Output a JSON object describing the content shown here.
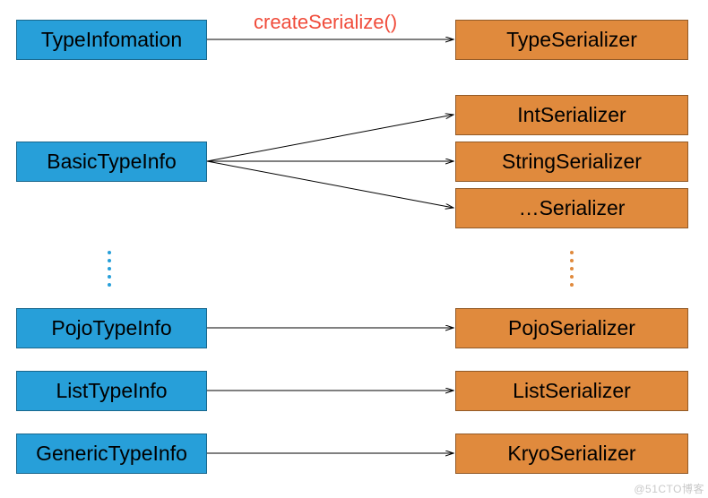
{
  "colors": {
    "blue": "#279fd9",
    "orange": "#e08a3d",
    "label": "#f04c3b",
    "watermark": "#c9c9c9"
  },
  "edgeLabel": "createSerialize()",
  "watermark": "@51CTO博客",
  "leftBoxes": {
    "typeInfo": "TypeInfomation",
    "basicTypeInfo": "BasicTypeInfo",
    "pojoTypeInfo": "PojoTypeInfo",
    "listTypeInfo": "ListTypeInfo",
    "genericTypeInfo": "GenericTypeInfo"
  },
  "rightBoxes": {
    "typeSerializer": "TypeSerializer",
    "intSerializer": "IntSerializer",
    "stringSerializer": "StringSerializer",
    "etcSerializer": "…Serializer",
    "pojoSerializer": "PojoSerializer",
    "listSerializer": "ListSerializer",
    "kryoSerializer": "KryoSerializer"
  },
  "chart_data": {
    "type": "diagram",
    "title": "",
    "nodes": [
      {
        "id": "TypeInfomation",
        "group": "typeinfo",
        "color": "blue"
      },
      {
        "id": "BasicTypeInfo",
        "group": "typeinfo",
        "color": "blue"
      },
      {
        "id": "PojoTypeInfo",
        "group": "typeinfo",
        "color": "blue"
      },
      {
        "id": "ListTypeInfo",
        "group": "typeinfo",
        "color": "blue"
      },
      {
        "id": "GenericTypeInfo",
        "group": "typeinfo",
        "color": "blue"
      },
      {
        "id": "TypeSerializer",
        "group": "serializer",
        "color": "orange"
      },
      {
        "id": "IntSerializer",
        "group": "serializer",
        "color": "orange"
      },
      {
        "id": "StringSerializer",
        "group": "serializer",
        "color": "orange"
      },
      {
        "id": "…Serializer",
        "group": "serializer",
        "color": "orange"
      },
      {
        "id": "PojoSerializer",
        "group": "serializer",
        "color": "orange"
      },
      {
        "id": "ListSerializer",
        "group": "serializer",
        "color": "orange"
      },
      {
        "id": "KryoSerializer",
        "group": "serializer",
        "color": "orange"
      }
    ],
    "edges": [
      {
        "from": "TypeInfomation",
        "to": "TypeSerializer",
        "label": "createSerialize()"
      },
      {
        "from": "BasicTypeInfo",
        "to": "IntSerializer"
      },
      {
        "from": "BasicTypeInfo",
        "to": "StringSerializer"
      },
      {
        "from": "BasicTypeInfo",
        "to": "…Serializer"
      },
      {
        "from": "PojoTypeInfo",
        "to": "PojoSerializer"
      },
      {
        "from": "ListTypeInfo",
        "to": "ListSerializer"
      },
      {
        "from": "GenericTypeInfo",
        "to": "KryoSerializer"
      }
    ],
    "ellipsis_between": [
      [
        "BasicTypeInfo",
        "PojoTypeInfo"
      ],
      [
        "…Serializer",
        "PojoSerializer"
      ]
    ]
  }
}
